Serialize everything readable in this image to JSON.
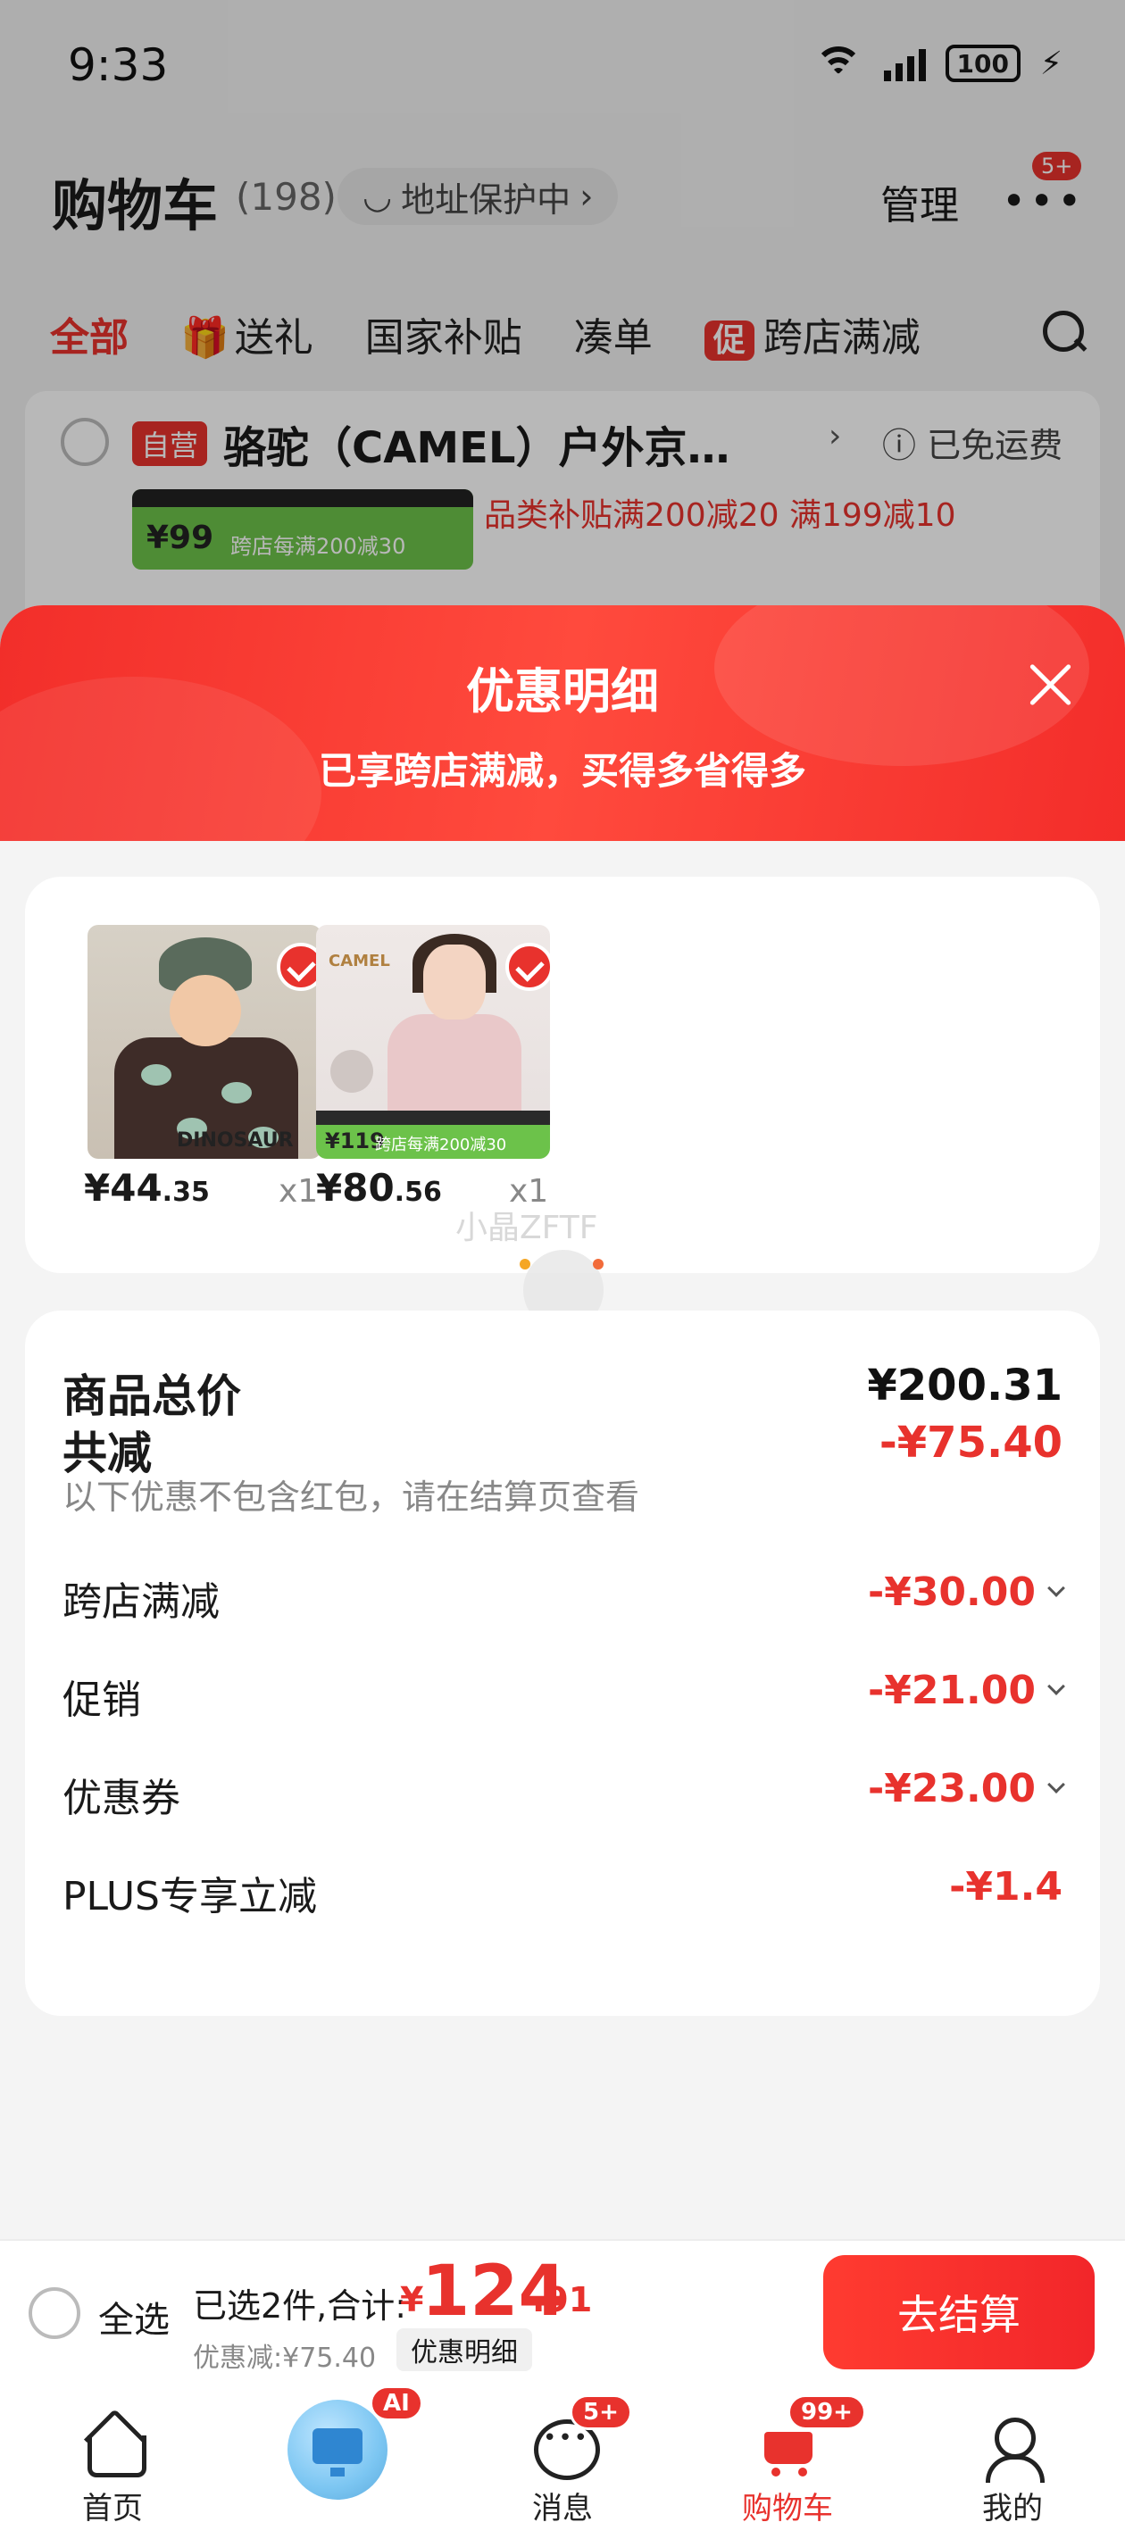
{
  "status_bar": {
    "time": "9:33",
    "battery": "100"
  },
  "header": {
    "title": "购物车",
    "count": "(198)",
    "address_protect": "地址保护中",
    "manage": "管理",
    "more_badge": "5+"
  },
  "tabs": [
    {
      "label": "全部"
    },
    {
      "label": "送礼"
    },
    {
      "label": "国家补贴"
    },
    {
      "label": "凑单"
    },
    {
      "label": "跨店满减",
      "tag": "促"
    }
  ],
  "store": {
    "tag": "自营",
    "name": "骆驼（CAMEL）户外京…",
    "shipping": "已免运费",
    "banner_price": "¥99",
    "banner_text": "跨店每满200减30",
    "subsidy": "品类补贴满200减20  满199减10"
  },
  "sheet": {
    "title": "优惠明细",
    "subtitle": "已享跨店满减，买得多省得多",
    "watermark": "小晶ZFTF"
  },
  "products": [
    {
      "price_int": "¥44",
      "price_dec": ".35",
      "qty": "x1",
      "print": "DINOSAUR"
    },
    {
      "price_int": "¥80",
      "price_dec": ".56",
      "qty": "x1",
      "logo": "CAMEL",
      "banner_price": "¥119",
      "banner_text": "跨店每满200减30"
    }
  ],
  "summary": {
    "total_label": "商品总价",
    "total_value": "¥200.31",
    "reduce_label": "共减",
    "reduce_value": "-¥75.40",
    "note": "以下优惠不包含红包，请在结算页查看",
    "items": [
      {
        "label": "跨店满减",
        "value": "-¥30.00"
      },
      {
        "label": "促销",
        "value": "-¥21.00"
      },
      {
        "label": "优惠券",
        "value": "-¥23.00"
      },
      {
        "label": "PLUS专享立减",
        "value": "-¥1.4"
      }
    ]
  },
  "checkout": {
    "select_all": "全选",
    "selected_text": "已选2件,合计:",
    "total_symbol": "¥",
    "total_int": "124",
    "total_dec": ".91",
    "discount_text": "优惠减:¥75.40",
    "detail_button": "优惠明细",
    "checkout_button": "去结算"
  },
  "tabbar": [
    {
      "label": "首页"
    },
    {
      "label": "",
      "badge": "AI"
    },
    {
      "label": "消息",
      "badge": "5+"
    },
    {
      "label": "购物车",
      "badge": "99+"
    },
    {
      "label": "我的"
    }
  ],
  "colors": {
    "accent": "#e8322d",
    "checkout_green": "#6cc24a"
  }
}
